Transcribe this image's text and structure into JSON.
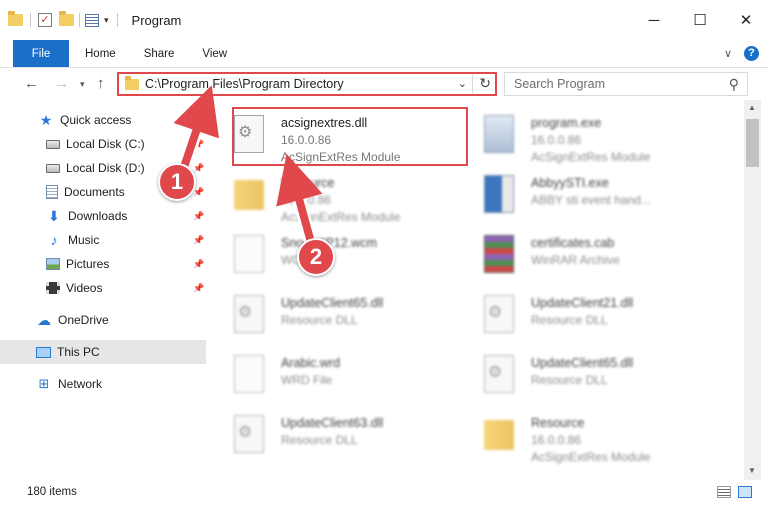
{
  "window": {
    "title": "Program",
    "minimize": "─",
    "maximize": "☐",
    "close": "✕"
  },
  "ribbon": {
    "tabs": [
      "File",
      "Home",
      "Share",
      "View"
    ],
    "collapse_glyph": "∨",
    "help_glyph": "?"
  },
  "address": {
    "path": "C:\\Program Files\\Program Directory",
    "search_placeholder": "Search Program"
  },
  "sidebar": {
    "items": [
      {
        "label": "Quick access",
        "icon": "star-icon",
        "pinned": false
      },
      {
        "label": "Local Disk (C:)",
        "icon": "disk-icon",
        "pinned": true
      },
      {
        "label": "Local Disk (D:)",
        "icon": "disk-icon",
        "pinned": true
      },
      {
        "label": "Documents",
        "icon": "documents-icon",
        "pinned": true
      },
      {
        "label": "Downloads",
        "icon": "download-icon",
        "pinned": true
      },
      {
        "label": "Music",
        "icon": "music-icon",
        "pinned": true
      },
      {
        "label": "Pictures",
        "icon": "pictures-icon",
        "pinned": true
      },
      {
        "label": "Videos",
        "icon": "videos-icon",
        "pinned": true
      },
      {
        "label": "OneDrive",
        "icon": "cloud-icon",
        "pinned": false
      },
      {
        "label": "This PC",
        "icon": "computer-icon",
        "pinned": false,
        "selected": true
      },
      {
        "label": "Network",
        "icon": "network-icon",
        "pinned": false
      }
    ]
  },
  "files": [
    {
      "name": "acsignextres.dll",
      "line2": "16.0.0.86",
      "line3": "AcSignExtRes Module",
      "icon": "dll-file-icon",
      "highlighted": true
    },
    {
      "name": "program.exe",
      "line2": "16.0.0.86",
      "line3": "AcSignExtRes Module",
      "icon": "exe-file-icon"
    },
    {
      "name": "Resource",
      "line2": "16.0.0.86",
      "line3": "AcSignExtRes Module",
      "icon": "folder-icon"
    },
    {
      "name": "AbbyySTI.exe",
      "line2": "ABBY sti event hand...",
      "line3": "",
      "icon": "exe-file-icon"
    },
    {
      "name": "SnooWIP12.wcm",
      "line2": "WCM File",
      "line3": "",
      "icon": "generic-file-icon"
    },
    {
      "name": "certificates.cab",
      "line2": "WinRAR Archive",
      "line3": "",
      "icon": "archive-icon"
    },
    {
      "name": "UpdateClient65.dll",
      "line2": "Resource DLL",
      "line3": "",
      "icon": "dll-file-icon"
    },
    {
      "name": "UpdateClient21.dll",
      "line2": "Resource DLL",
      "line3": "",
      "icon": "dll-file-icon"
    },
    {
      "name": "Arabic.wrd",
      "line2": "WRD File",
      "line3": "",
      "icon": "generic-file-icon"
    },
    {
      "name": "UpdateClient65.dll",
      "line2": "Resource DLL",
      "line3": "",
      "icon": "dll-file-icon"
    },
    {
      "name": "UpdateClient63.dll",
      "line2": "Resource DLL",
      "line3": "",
      "icon": "dll-file-icon"
    },
    {
      "name": "Resource",
      "line2": "16.0.0.86",
      "line3": "AcSignExtRes Module",
      "icon": "folder-icon"
    }
  ],
  "annotations": {
    "step1": "1",
    "step2": "2",
    "highlight_color": "#e0484b"
  },
  "status": {
    "item_count": "180 items"
  },
  "colors": {
    "accent": "#1a6fc9",
    "selected_bg": "#e6e6e6"
  }
}
